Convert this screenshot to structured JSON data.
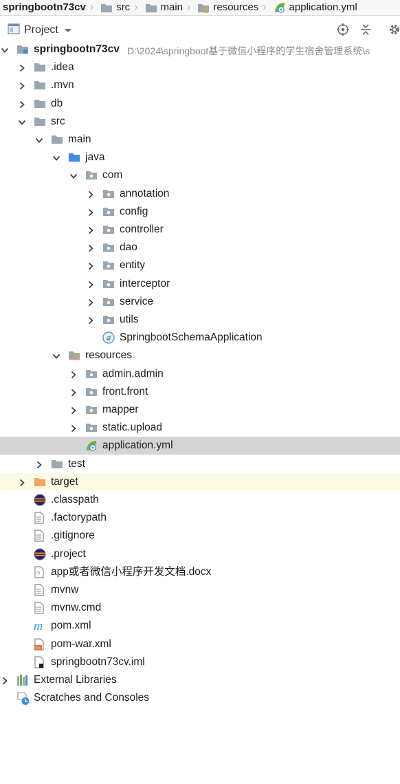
{
  "breadcrumb": [
    {
      "label": "springbootn73cv",
      "icon": "module-folder-icon"
    },
    {
      "label": "src",
      "icon": "folder-icon"
    },
    {
      "label": "main",
      "icon": "folder-icon"
    },
    {
      "label": "resources",
      "icon": "resources-folder-icon"
    },
    {
      "label": "application.yml",
      "icon": "spring-config-icon"
    }
  ],
  "toolbar": {
    "title": "Project"
  },
  "tree": [
    {
      "label": "springbootn73cv",
      "path": "D:\\2024\\springboot基于微信小程序的学生宿舍管理系统\\s",
      "level": 0,
      "state": "expanded",
      "icon": "module-folder",
      "bold": true
    },
    {
      "label": ".idea",
      "level": 1,
      "state": "collapsed",
      "icon": "folder"
    },
    {
      "label": ".mvn",
      "level": 1,
      "state": "collapsed",
      "icon": "folder"
    },
    {
      "label": "db",
      "level": 1,
      "state": "collapsed",
      "icon": "folder"
    },
    {
      "label": "src",
      "level": 1,
      "state": "expanded",
      "icon": "folder"
    },
    {
      "label": "main",
      "level": 2,
      "state": "expanded",
      "icon": "folder"
    },
    {
      "label": "java",
      "level": 3,
      "state": "expanded",
      "icon": "source-folder"
    },
    {
      "label": "com",
      "level": 4,
      "state": "expanded",
      "icon": "package"
    },
    {
      "label": "annotation",
      "level": 5,
      "state": "collapsed",
      "icon": "package"
    },
    {
      "label": "config",
      "level": 5,
      "state": "collapsed",
      "icon": "package"
    },
    {
      "label": "controller",
      "level": 5,
      "state": "collapsed",
      "icon": "package"
    },
    {
      "label": "dao",
      "level": 5,
      "state": "collapsed",
      "icon": "package"
    },
    {
      "label": "entity",
      "level": 5,
      "state": "collapsed",
      "icon": "package"
    },
    {
      "label": "interceptor",
      "level": 5,
      "state": "collapsed",
      "icon": "package"
    },
    {
      "label": "service",
      "level": 5,
      "state": "collapsed",
      "icon": "package"
    },
    {
      "label": "utils",
      "level": 5,
      "state": "collapsed",
      "icon": "package"
    },
    {
      "label": "SpringbootSchemaApplication",
      "level": 5,
      "state": "leaf",
      "icon": "spring-boot-class"
    },
    {
      "label": "resources",
      "level": 3,
      "state": "expanded",
      "icon": "resources-folder"
    },
    {
      "label": "admin.admin",
      "level": 4,
      "state": "collapsed",
      "icon": "package"
    },
    {
      "label": "front.front",
      "level": 4,
      "state": "collapsed",
      "icon": "package"
    },
    {
      "label": "mapper",
      "level": 4,
      "state": "collapsed",
      "icon": "package"
    },
    {
      "label": "static.upload",
      "level": 4,
      "state": "collapsed",
      "icon": "package"
    },
    {
      "label": "application.yml",
      "level": 4,
      "state": "leaf",
      "icon": "spring-config",
      "selected": true
    },
    {
      "label": "test",
      "level": 2,
      "state": "collapsed",
      "icon": "folder"
    },
    {
      "label": "target",
      "level": 1,
      "state": "collapsed",
      "icon": "excluded-folder",
      "excluded": true
    },
    {
      "label": ".classpath",
      "level": 1,
      "state": "leaf",
      "icon": "eclipse"
    },
    {
      "label": ".factorypath",
      "level": 1,
      "state": "leaf",
      "icon": "file"
    },
    {
      "label": ".gitignore",
      "level": 1,
      "state": "leaf",
      "icon": "file"
    },
    {
      "label": ".project",
      "level": 1,
      "state": "leaf",
      "icon": "eclipse"
    },
    {
      "label": "app或者微信小程序开发文档.docx",
      "level": 1,
      "state": "leaf",
      "icon": "unknown-file"
    },
    {
      "label": "mvnw",
      "level": 1,
      "state": "leaf",
      "icon": "file"
    },
    {
      "label": "mvnw.cmd",
      "level": 1,
      "state": "leaf",
      "icon": "file"
    },
    {
      "label": "pom.xml",
      "level": 1,
      "state": "leaf",
      "icon": "maven"
    },
    {
      "label": "pom-war.xml",
      "level": 1,
      "state": "leaf",
      "icon": "xml"
    },
    {
      "label": "springbootn73cv.iml",
      "level": 1,
      "state": "leaf",
      "icon": "iml"
    },
    {
      "label": "External Libraries",
      "level": 0,
      "state": "collapsed",
      "icon": "libraries"
    },
    {
      "label": "Scratches and Consoles",
      "level": 0,
      "state": "leaf",
      "icon": "scratches"
    }
  ],
  "colors": {
    "selection": "#d5d5d5",
    "excluded_bg": "#fdfbe6",
    "folder": "#9aa7b0",
    "excluded_folder": "#f4a460",
    "spring": "#6db33f",
    "path": "#8a8a8a"
  }
}
